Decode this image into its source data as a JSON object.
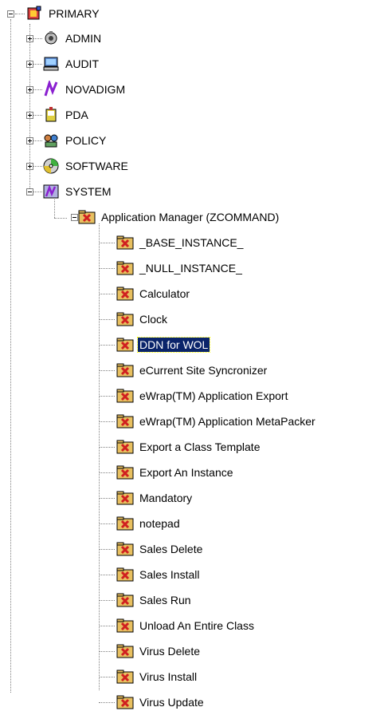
{
  "tree": {
    "root": {
      "label": "PRIMARY",
      "icon": "primary-database-icon",
      "expanded": true
    },
    "children": [
      {
        "label": "ADMIN",
        "icon": "admin-icon",
        "expanded": false
      },
      {
        "label": "AUDIT",
        "icon": "audit-computer-icon",
        "expanded": false
      },
      {
        "label": "NOVADIGM",
        "icon": "novadigm-logo-icon",
        "expanded": false
      },
      {
        "label": "PDA",
        "icon": "pda-icon",
        "expanded": false
      },
      {
        "label": "POLICY",
        "icon": "policy-icon",
        "expanded": false
      },
      {
        "label": "SOFTWARE",
        "icon": "software-disc-icon",
        "expanded": false
      },
      {
        "label": "SYSTEM",
        "icon": "system-icon",
        "expanded": true
      }
    ],
    "application_manager": {
      "label": "Application Manager (ZCOMMAND)",
      "icon": "class-folder-icon",
      "expanded": true
    },
    "instances": [
      {
        "label": "_BASE_INSTANCE_"
      },
      {
        "label": "_NULL_INSTANCE_"
      },
      {
        "label": "Calculator"
      },
      {
        "label": "Clock"
      },
      {
        "label": "DDN for WOL",
        "selected": true
      },
      {
        "label": "eCurrent Site Syncronizer"
      },
      {
        "label": "eWrap(TM) Application Export"
      },
      {
        "label": "eWrap(TM) Application MetaPacker"
      },
      {
        "label": "Export a Class Template"
      },
      {
        "label": "Export An Instance"
      },
      {
        "label": "Mandatory"
      },
      {
        "label": "notepad"
      },
      {
        "label": "Sales Delete"
      },
      {
        "label": "Sales Install"
      },
      {
        "label": "Sales Run"
      },
      {
        "label": "Unload An Entire Class"
      },
      {
        "label": "Virus Delete"
      },
      {
        "label": "Virus Install"
      },
      {
        "label": "Virus Update"
      }
    ],
    "instance_icon": "instance-folder-icon",
    "colors": {
      "selection": "#0a246a",
      "selection_text": "#ffffff",
      "lines": "#808080"
    }
  }
}
